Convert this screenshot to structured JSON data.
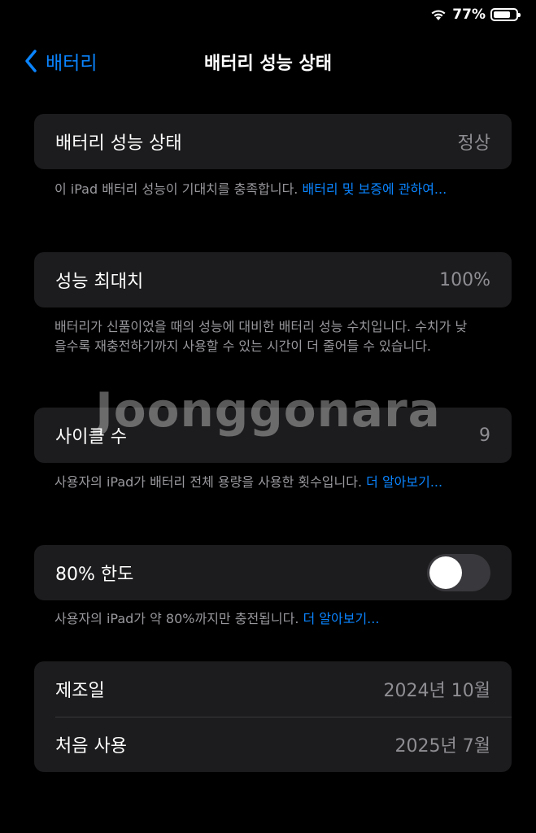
{
  "status_bar": {
    "battery_percent": "77%",
    "battery_level": 0.77
  },
  "nav": {
    "back_label": "배터리",
    "title": "배터리 성능 상태"
  },
  "health": {
    "label": "배터리 성능 상태",
    "value": "정상",
    "note": "이 iPad 배터리 성능이 기대치를 충족합니다. ",
    "note_link": "배터리 및 보증에 관하여..."
  },
  "max_capacity": {
    "label": "성능 최대치",
    "value": "100%",
    "note": "배터리가 신품이었을 때의 성능에 대비한 배터리 성능 수치입니다. 수치가 낮을수록 재충전하기까지 사용할 수 있는 시간이 더 줄어들 수 있습니다."
  },
  "cycle_count": {
    "label": "사이클 수",
    "value": "9",
    "note": "사용자의 iPad가 배터리 전체 용량을 사용한 횟수입니다. ",
    "note_link": "더 알아보기..."
  },
  "limit_80": {
    "label": "80% 한도",
    "enabled": false,
    "note": "사용자의 iPad가 약 80%까지만 충전됩니다. ",
    "note_link": "더 알아보기..."
  },
  "dates": {
    "manufacture_label": "제조일",
    "manufacture_value": "2024년 10월",
    "first_use_label": "처음 사용",
    "first_use_value": "2025년 7월"
  },
  "watermark": "Joonggonara"
}
